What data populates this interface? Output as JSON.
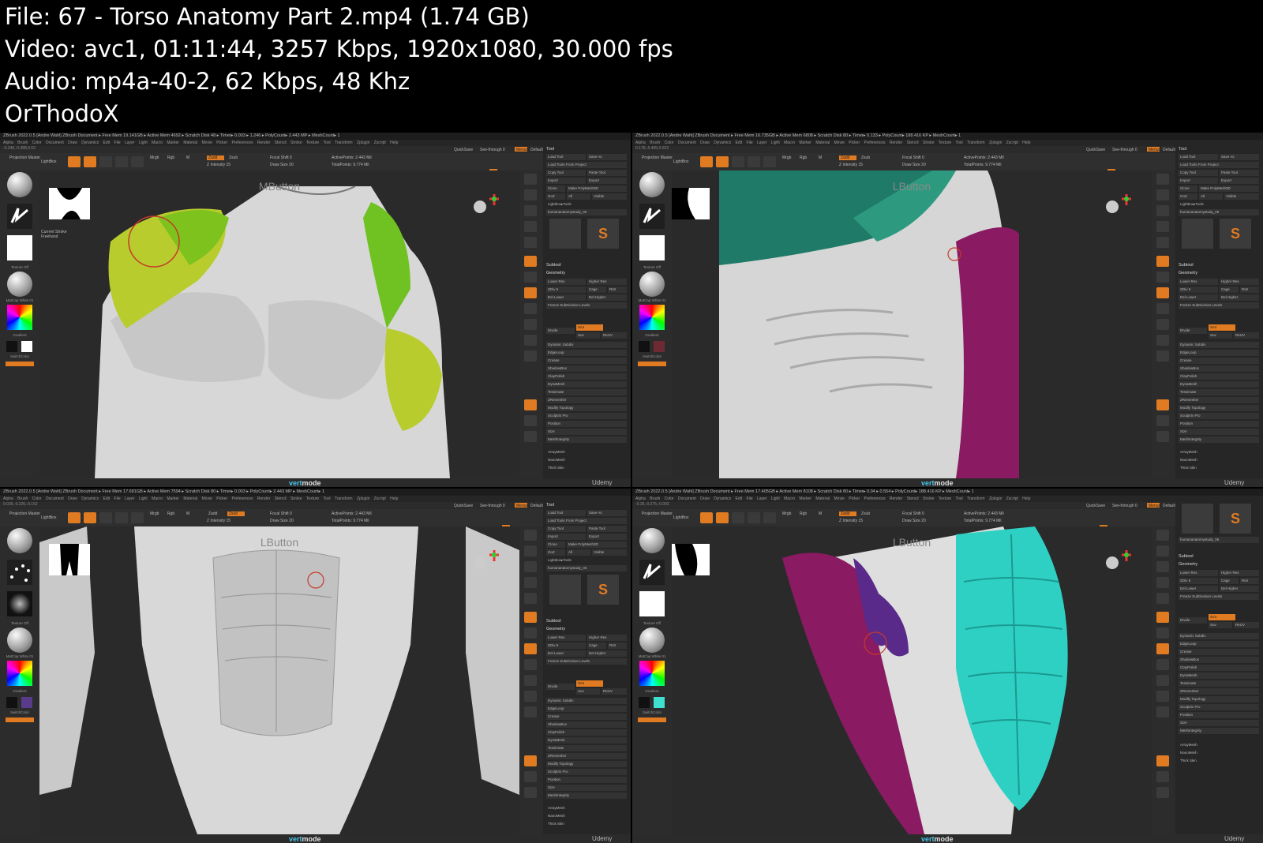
{
  "info": {
    "file": "File: 67 - Torso Anatomy Part 2.mp4 (1.74 GB)",
    "video": "Video: avc1, 01:11:44, 3257 Kbps, 1920x1080, 30.000 fps",
    "audio": "Audio: mp4a-40-2, 62 Kbps, 48 Khz",
    "author": "OrThodoX"
  },
  "common": {
    "menu": "Alpha  Brush  Color  Document  Draw  Dynamics  Edit  File  Layer  Light  Macro  Marker  Material  Movie  Picker  Preferences  Render  Stencil  Stroke  Texture  Tool  Transform  Zplugin  Zscript  Help",
    "quicksave": "QuickSave",
    "seethrough": "See-through 0",
    "menus": "Menus",
    "defaultscript": "DefaultZScript",
    "lightbox": "LightBox",
    "projection": "Projection Master",
    "tool_title": "Tool",
    "load_tool": "Load Tool",
    "save_as": "Save As",
    "load_tools_project": "Load Tools From Project",
    "copy_tool": "Copy Tool",
    "paste_tool": "Paste Tool",
    "import": "Import",
    "export": "Export",
    "clone": "Clone",
    "make_polymesh": "Make PolyMesh3D",
    "goz": "GoZ",
    "all": "All",
    "visible": "Visible",
    "lightbox_tools": "Lightbox▸Tools",
    "subtool": "Subtool",
    "geometry": "Geometry",
    "lower_res": "Lower Res",
    "higher_res": "Higher Res",
    "sdiv": "SDiv 6",
    "cage": "Cage",
    "rstr": "Rstr",
    "del_lower": "Del Lower",
    "del_higher": "Del Higher",
    "freeze": "Freeze SubDivision Levels",
    "divide": "Divide",
    "smt": "Smt",
    "suv": "Suv",
    "relaxuv": "ReUV",
    "dynamic_subdiv": "Dynamic Subdiv",
    "edgeloop": "EdgeLoop",
    "crease": "Crease",
    "shadowbox": "ShadowBox",
    "claypolish": "ClayPolish",
    "dynamesh": "DynaMesh",
    "tessimate": "Tessimate",
    "zremesher": "ZRemesher",
    "modify_topology": "Modify Topology",
    "sculptris": "Sculptris Pro",
    "position": "Position",
    "size": "Size",
    "meshintegrity": "MeshIntegrity",
    "arraymesh": "ArrayMesh",
    "nanomesh": "NanoMesh",
    "thick_skin": "Thick Skin",
    "matcap": "MatCap White 01",
    "gradient": "Gradient",
    "switchcolor": "SwitchColor",
    "alternate": "Alternate",
    "texture_off": "Texture Off",
    "vertmode_a": "vert",
    "vertmode_b": "mode",
    "udemy": "Udemy",
    "focal_shift": "Focal Shift 0",
    "active_points": "ActivePoints: 2.443 Mil",
    "total_points": "TotalPoints: 9.774 Mil",
    "zadd": "Zadd",
    "zsub": "Zsub",
    "mrgb": "Mrgb",
    "rgb": "Rgb",
    "m": "M",
    "z_intensity": "Z Intensity 15",
    "draw_size": "Draw Size 20"
  },
  "panels": [
    {
      "title": "ZBrush 2022.0.5 [Andre Wahl]  ZBrush Document  ▸ Free Mem 19.141GB ▸ Active Mem 4692 ▸ Scratch Disk 48 ▸ Timer▸ 0.003 ▸ 1.246 ▸ PolyCount▸ 2.443 MP ▸ MeshCount▸ 1",
      "coords": "-0.246,-0.388,0.62",
      "brush_label": "MButton",
      "stroke": "Current Stroke",
      "stroke_type": "Freehand",
      "tool_name": "humananatomystudy_06"
    },
    {
      "title": "ZBrush 2022.0.5 [Andre Wahl]  ZBrush Document  ▸ Free Mem 16.735GB ▸ Active Mem 6808 ▸ Scratch Disk 80 ▸ Timer▸ 0.133 ▸ PolyCount▸ 188.416 KP ▸ MeshCount▸ 1",
      "coords": "0.178,-0.405,0.023",
      "brush_label": "LButton",
      "stroke": "",
      "stroke_type": "",
      "tool_name": "humananatomystudy_06"
    },
    {
      "title": "ZBrush 2022.0.5 [Andre Wahl]  ZBrush Document  ▸ Free Mem 17.681GB ▸ Active Mem 7594 ▸ Scratch Disk 80 ▸ Timer▸ 0.003 ▸ PolyCount▸ 2.443 MP ▸ MeshCount▸ 1",
      "coords": "0.036,-0.226,-0.152",
      "brush_label": "LButton",
      "stroke": "",
      "stroke_type": "",
      "tool_name": "humananatomystudy_06"
    },
    {
      "title": "ZBrush 2022.0.5 [Andre Wahl]  ZBrush Document  ▸ Free Mem 17.405GB ▸ Active Mem 8108 ▸ Scratch Disk 80 ▸ Timer▸ 0.04 ▸ 0.554 ▸ PolyCount▸ 188.416 KP ▸ MeshCount▸ 1",
      "coords": "-0.36,-0.275,-0.003",
      "brush_label": "LButton",
      "stroke": "",
      "stroke_type": "",
      "tool_name": "humananatomystudy_06"
    }
  ]
}
